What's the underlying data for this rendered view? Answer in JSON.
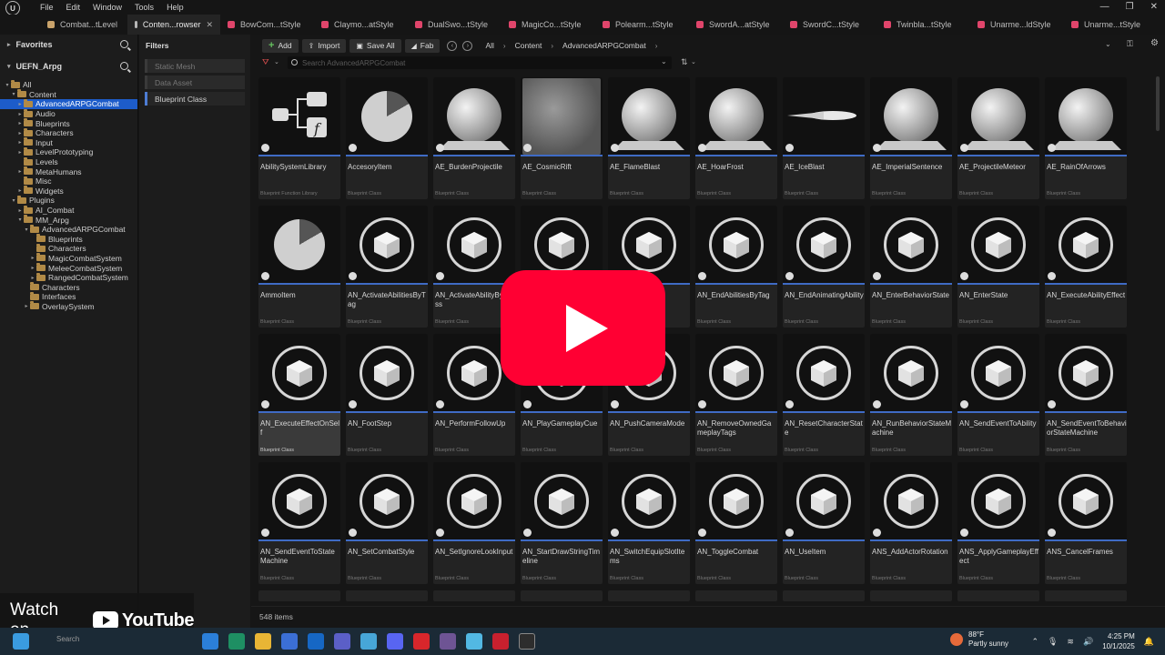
{
  "menu": {
    "logo": "U",
    "items": [
      "File",
      "Edit",
      "Window",
      "Tools",
      "Help"
    ],
    "window_controls": [
      "—",
      "❐",
      "✕"
    ]
  },
  "tabs": [
    {
      "label": "Combat...tLevel",
      "color": "#c9a36b"
    },
    {
      "label": "Conten...rowser",
      "color": "#b7b7b7",
      "active": true,
      "close": "✕"
    },
    {
      "label": "BowCom...tStyle",
      "color": "#e0456b"
    },
    {
      "label": "Claymo...atStyle",
      "color": "#e0456b"
    },
    {
      "label": "DualSwo...tStyle",
      "color": "#e0456b"
    },
    {
      "label": "MagicCo...tStyle",
      "color": "#e0456b"
    },
    {
      "label": "Polearm...tStyle",
      "color": "#e0456b"
    },
    {
      "label": "SwordA...atStyle",
      "color": "#e0456b"
    },
    {
      "label": "SwordC...tStyle",
      "color": "#e0456b"
    },
    {
      "label": "Twinbla...tStyle",
      "color": "#e0456b"
    },
    {
      "label": "Unarme...ldStyle",
      "color": "#e0456b"
    },
    {
      "label": "Unarme...tStyle",
      "color": "#e0456b"
    }
  ],
  "favorites_label": "Favorites",
  "project_label": "UEFN_Arpg",
  "tree": [
    {
      "label": "All",
      "depth": 0,
      "caret": "▾"
    },
    {
      "label": "Content",
      "depth": 1,
      "caret": "▾"
    },
    {
      "label": "AdvancedARPGCombat",
      "depth": 2,
      "caret": "▸",
      "selected": true
    },
    {
      "label": "Audio",
      "depth": 2,
      "caret": "▸"
    },
    {
      "label": "Blueprints",
      "depth": 2,
      "caret": "▸"
    },
    {
      "label": "Characters",
      "depth": 2,
      "caret": "▸"
    },
    {
      "label": "Input",
      "depth": 2,
      "caret": "▸"
    },
    {
      "label": "LevelPrototyping",
      "depth": 2,
      "caret": "▸"
    },
    {
      "label": "Levels",
      "depth": 2,
      "caret": ""
    },
    {
      "label": "MetaHumans",
      "depth": 2,
      "caret": "▸"
    },
    {
      "label": "Misc",
      "depth": 2,
      "caret": ""
    },
    {
      "label": "Widgets",
      "depth": 2,
      "caret": "▸"
    },
    {
      "label": "Plugins",
      "depth": 1,
      "caret": "▾"
    },
    {
      "label": "AI_Combat",
      "depth": 2,
      "caret": "▸"
    },
    {
      "label": "MM_Arpg",
      "depth": 2,
      "caret": "▾"
    },
    {
      "label": "AdvancedARPGCombat",
      "depth": 3,
      "caret": "▾"
    },
    {
      "label": "Blueprints",
      "depth": 4,
      "caret": ""
    },
    {
      "label": "Characters",
      "depth": 4,
      "caret": ""
    },
    {
      "label": "MagicCombatSystem",
      "depth": 4,
      "caret": "▸"
    },
    {
      "label": "MeleeCombatSystem",
      "depth": 4,
      "caret": "▸"
    },
    {
      "label": "RangedCombatSystem",
      "depth": 4,
      "caret": "▸"
    },
    {
      "label": "Characters",
      "depth": 3,
      "caret": ""
    },
    {
      "label": "Interfaces",
      "depth": 3,
      "caret": ""
    },
    {
      "label": "OverlaySystem",
      "depth": 3,
      "caret": "▸"
    }
  ],
  "filters": {
    "title": "Filters",
    "chips": [
      {
        "label": "Static Mesh",
        "on": false
      },
      {
        "label": "Data Asset",
        "on": false
      },
      {
        "label": "Blueprint Class",
        "on": true
      }
    ]
  },
  "toolbar": {
    "add": "Add",
    "import": "Import",
    "save_all": "Save All",
    "fab": "Fab",
    "breadcrumbs": [
      "All",
      "Content",
      "AdvancedARPGCombat"
    ]
  },
  "search": {
    "placeholder": "Search AdvancedARPGCombat"
  },
  "assets": [
    {
      "name": "AbilitySystemLibrary",
      "type": "Blueprint Function Library",
      "thumb": "func"
    },
    {
      "name": "AccesoryItem",
      "type": "Blueprint Class",
      "thumb": "pie"
    },
    {
      "name": "AE_BurdenProjectile",
      "type": "Blueprint Class",
      "thumb": "sphere"
    },
    {
      "name": "AE_CosmicRift",
      "type": "Blueprint Class",
      "thumb": "check"
    },
    {
      "name": "AE_FlameBlast",
      "type": "Blueprint Class",
      "thumb": "sphere"
    },
    {
      "name": "AE_HoarFrost",
      "type": "Blueprint Class",
      "thumb": "sphere"
    },
    {
      "name": "AE_IceBlast",
      "type": "Blueprint Class",
      "thumb": "streak"
    },
    {
      "name": "AE_ImperialSentence",
      "type": "Blueprint Class",
      "thumb": "sphere"
    },
    {
      "name": "AE_ProjectileMeteor",
      "type": "Blueprint Class",
      "thumb": "sphere"
    },
    {
      "name": "AE_RainOfArrows",
      "type": "Blueprint Class",
      "thumb": "sphere"
    },
    {
      "name": "AmmoItem",
      "type": "Blueprint Class",
      "thumb": "pie"
    },
    {
      "name": "AN_ActivateAbilitiesByTag",
      "type": "Blueprint Class",
      "thumb": "cube"
    },
    {
      "name": "AN_ActivateAbilityByClass",
      "type": "Blueprint Class",
      "thumb": "cube"
    },
    {
      "name": "",
      "type": "",
      "thumb": "cube"
    },
    {
      "name": "lay",
      "type": "",
      "thumb": "cube"
    },
    {
      "name": "AN_EndAbilitiesByTag",
      "type": "Blueprint Class",
      "thumb": "cube"
    },
    {
      "name": "AN_EndAnimatingAbility",
      "type": "Blueprint Class",
      "thumb": "cube"
    },
    {
      "name": "AN_EnterBehaviorState",
      "type": "Blueprint Class",
      "thumb": "cube"
    },
    {
      "name": "AN_EnterState",
      "type": "Blueprint Class",
      "thumb": "cube"
    },
    {
      "name": "AN_ExecuteAbilityEffect",
      "type": "Blueprint Class",
      "thumb": "cube"
    },
    {
      "name": "AN_ExecuteEffectOnSelf",
      "type": "Blueprint Class",
      "thumb": "cube",
      "selected": true
    },
    {
      "name": "AN_FootStep",
      "type": "Blueprint Class",
      "thumb": "cube"
    },
    {
      "name": "AN_PerformFollowUp",
      "type": "Blueprint Class",
      "thumb": "cube"
    },
    {
      "name": "AN_PlayGameplayCue",
      "type": "Blueprint Class",
      "thumb": "cube"
    },
    {
      "name": "AN_PushCameraMode",
      "type": "Blueprint Class",
      "thumb": "cube"
    },
    {
      "name": "AN_RemoveOwnedGameplayTags",
      "type": "Blueprint Class",
      "thumb": "cube"
    },
    {
      "name": "AN_ResetCharacterState",
      "type": "Blueprint Class",
      "thumb": "cube"
    },
    {
      "name": "AN_RunBehaviorStateMachine",
      "type": "Blueprint Class",
      "thumb": "cube"
    },
    {
      "name": "AN_SendEventToAbility",
      "type": "Blueprint Class",
      "thumb": "cube"
    },
    {
      "name": "AN_SendEventToBehaviorStateMachine",
      "type": "Blueprint Class",
      "thumb": "cube"
    },
    {
      "name": "AN_SendEventToStateMachine",
      "type": "Blueprint Class",
      "thumb": "cube"
    },
    {
      "name": "AN_SetCombatStyle",
      "type": "Blueprint Class",
      "thumb": "cube"
    },
    {
      "name": "AN_SetIgnoreLookInput",
      "type": "Blueprint Class",
      "thumb": "cube"
    },
    {
      "name": "AN_StartDrawStringTimeline",
      "type": "Blueprint Class",
      "thumb": "cube"
    },
    {
      "name": "AN_SwitchEquipSlotItems",
      "type": "Blueprint Class",
      "thumb": "cube"
    },
    {
      "name": "AN_ToggleCombat",
      "type": "Blueprint Class",
      "thumb": "cube"
    },
    {
      "name": "AN_UseItem",
      "type": "Blueprint Class",
      "thumb": "cube"
    },
    {
      "name": "ANS_AddActorRotation",
      "type": "Blueprint Class",
      "thumb": "cube"
    },
    {
      "name": "ANS_ApplyGameplayEffect",
      "type": "Blueprint Class",
      "thumb": "cube"
    },
    {
      "name": "ANS_CancelFrames",
      "type": "Blueprint Class",
      "thumb": "cube"
    }
  ],
  "status": {
    "item_count": "548 items"
  },
  "watch_overlay": {
    "watch_on": "Watch on",
    "youtube": "YouTube"
  },
  "taskbar": {
    "search_placeholder": "Search",
    "weather_temp": "88°F",
    "weather_desc": "Partly sunny",
    "time": "4:25 PM",
    "date": "10/1/2025"
  }
}
